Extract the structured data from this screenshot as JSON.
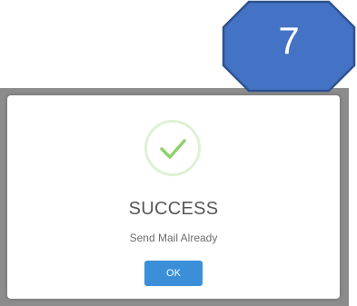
{
  "dialog": {
    "icon": "checkmark-circle-icon",
    "title": "SUCCESS",
    "message": "Send Mail Already",
    "ok_label": "OK"
  },
  "step_badge": {
    "number": "7"
  },
  "colors": {
    "badge_fill": "#4472c4",
    "badge_stroke": "#2f528f",
    "check": "#8fd16a",
    "check_ring": "#dff1d5",
    "ok_button": "#3a8fd8",
    "backdrop": "#8c8c8c"
  }
}
